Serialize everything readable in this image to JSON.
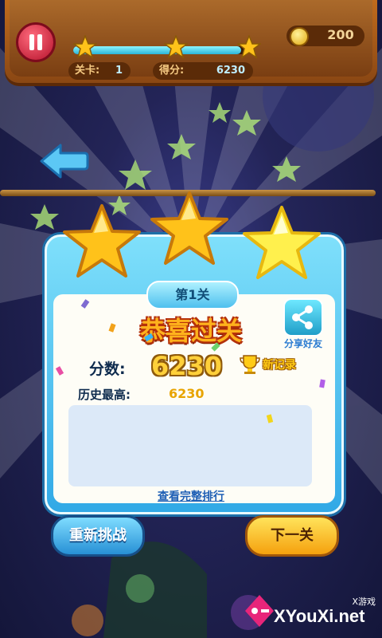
{
  "hud": {
    "level_label": "关卡:",
    "level_value": "1",
    "score_label": "得分:",
    "score_value": "6230",
    "coins": "200",
    "progress_fraction": 0.95
  },
  "result": {
    "level_title": "第1关",
    "congrats": "恭喜过关",
    "share_label": "分享好友",
    "score_label": "分数:",
    "score_value": "6230",
    "new_record": "新记录",
    "history_label": "历史最高:",
    "history_value": "6230",
    "rank_link": "查看完整排行",
    "stars_earned": 3
  },
  "buttons": {
    "retry": "重新挑战",
    "next": "下一关"
  },
  "watermark": {
    "brand": "XYouXi.net",
    "small": "X游戏"
  },
  "colors": {
    "panel": "#31a9e6",
    "star": "#ffc21a",
    "retry_button": "#2790d5",
    "next_button": "#f5a10e"
  }
}
